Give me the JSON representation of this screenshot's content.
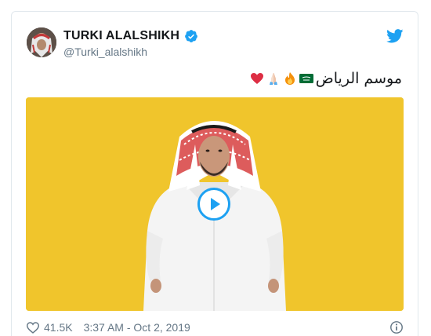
{
  "tweet": {
    "display_name": "TURKI ALALSHIKH",
    "handle": "@Turki_alalshikh",
    "text": "موسم الرياض",
    "emojis": [
      "saudi-flag",
      "fire",
      "folded-hands",
      "red-heart"
    ],
    "verified": true
  },
  "video": {
    "background_color": "#f0c52c"
  },
  "footer": {
    "like_count": "41.5K",
    "timestamp": "3:37 AM - Oct 2, 2019"
  },
  "colors": {
    "twitter_blue": "#1da1f2",
    "secondary_text": "#657786"
  }
}
